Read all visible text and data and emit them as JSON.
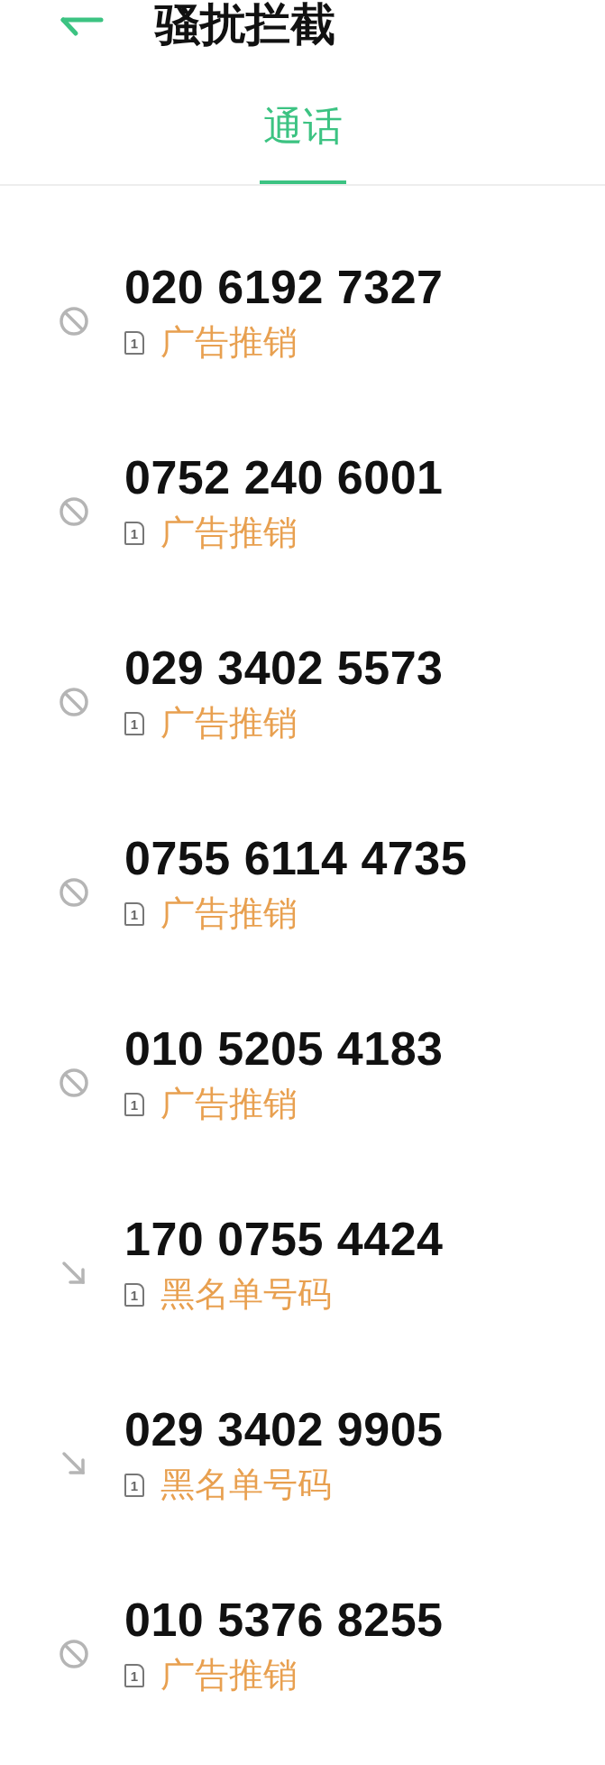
{
  "header": {
    "title": "骚扰拦截"
  },
  "tabs": [
    {
      "label": "通话",
      "selected": true
    }
  ],
  "calls": [
    {
      "kind": "blocked",
      "number": "020 6192 7327",
      "sim": "1",
      "tag": "广告推销"
    },
    {
      "kind": "blocked",
      "number": "0752 240 6001",
      "sim": "1",
      "tag": "广告推销"
    },
    {
      "kind": "blocked",
      "number": "029 3402 5573",
      "sim": "1",
      "tag": "广告推销"
    },
    {
      "kind": "blocked",
      "number": "0755 6114 4735",
      "sim": "1",
      "tag": "广告推销"
    },
    {
      "kind": "blocked",
      "number": "010 5205 4183",
      "sim": "1",
      "tag": "广告推销"
    },
    {
      "kind": "incoming",
      "number": "170 0755 4424",
      "sim": "1",
      "tag": "黑名单号码"
    },
    {
      "kind": "incoming",
      "number": "029 3402 9905",
      "sim": "1",
      "tag": "黑名单号码"
    },
    {
      "kind": "blocked",
      "number": "010 5376 8255",
      "sim": "1",
      "tag": "广告推销"
    }
  ]
}
